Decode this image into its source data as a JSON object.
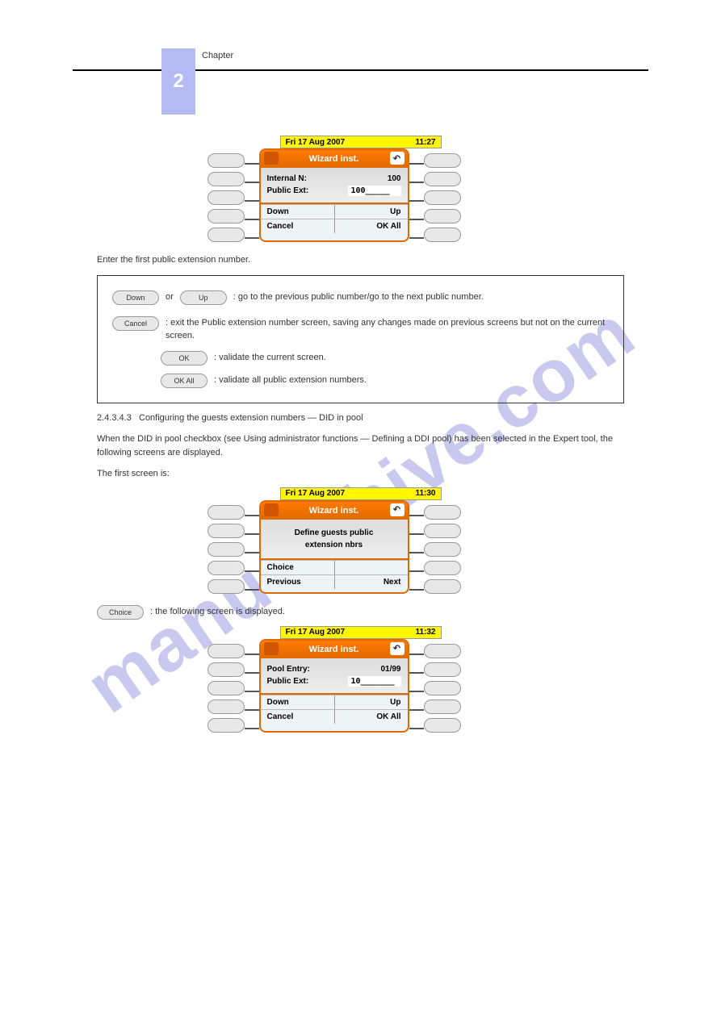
{
  "chapter": {
    "number": "2",
    "label": "Chapter"
  },
  "phone1": {
    "date": "Fri 17 Aug 2007",
    "time": "11:27",
    "title": "Wizard inst.",
    "row1_label": "Internal N:",
    "row1_value": "100",
    "row2_label": "Public Ext:",
    "row2_value": "100_____",
    "soft1_left": "Down",
    "soft1_right": "Up",
    "soft2_left": "Cancel",
    "soft2_right": "OK All"
  },
  "para_enter_first": "Enter the first public extension number.",
  "box": {
    "a1_btn": "Down",
    "a1_or": "or",
    "a1_btn2": "Up",
    "a1_text": ": go to the previous public number/go to the next public number.",
    "a2_btn": "Cancel",
    "a2_text": ": exit the Public extension number screen, saving any changes made on previous screens but not on the current screen.",
    "a3_btn": "OK",
    "a3_text": ": validate the current screen.",
    "a4_btn": "OK All",
    "a4_text": ": validate all public extension numbers."
  },
  "section": {
    "num": "2.4.3.4.3",
    "label": "Configuring the guests extension numbers — DID in pool",
    "para_pool": "When the DID in pool checkbox (see Using administrator functions — Defining a DDI pool) has been selected in the Expert tool, the following screens are displayed.",
    "para_first": "The first screen is:"
  },
  "phone2": {
    "date": "Fri 17 Aug 2007",
    "time": "11:30",
    "title": "Wizard inst.",
    "msg1": "Define guests public",
    "msg2": "extension nbrs",
    "soft1_left": "Choice",
    "soft2_left": "Previous",
    "soft2_right": "Next"
  },
  "inline": {
    "btn": "Choice",
    "after": ": the following screen is displayed."
  },
  "phone3": {
    "date": "Fri 17 Aug 2007",
    "time": "11:32",
    "title": "Wizard inst.",
    "row1_label": "Pool Entry:",
    "row1_value": "01/99",
    "row2_label": "Public Ext:",
    "row2_value": "10_______",
    "soft1_left": "Down",
    "soft1_right": "Up",
    "soft2_left": "Cancel",
    "soft2_right": "OK All"
  }
}
